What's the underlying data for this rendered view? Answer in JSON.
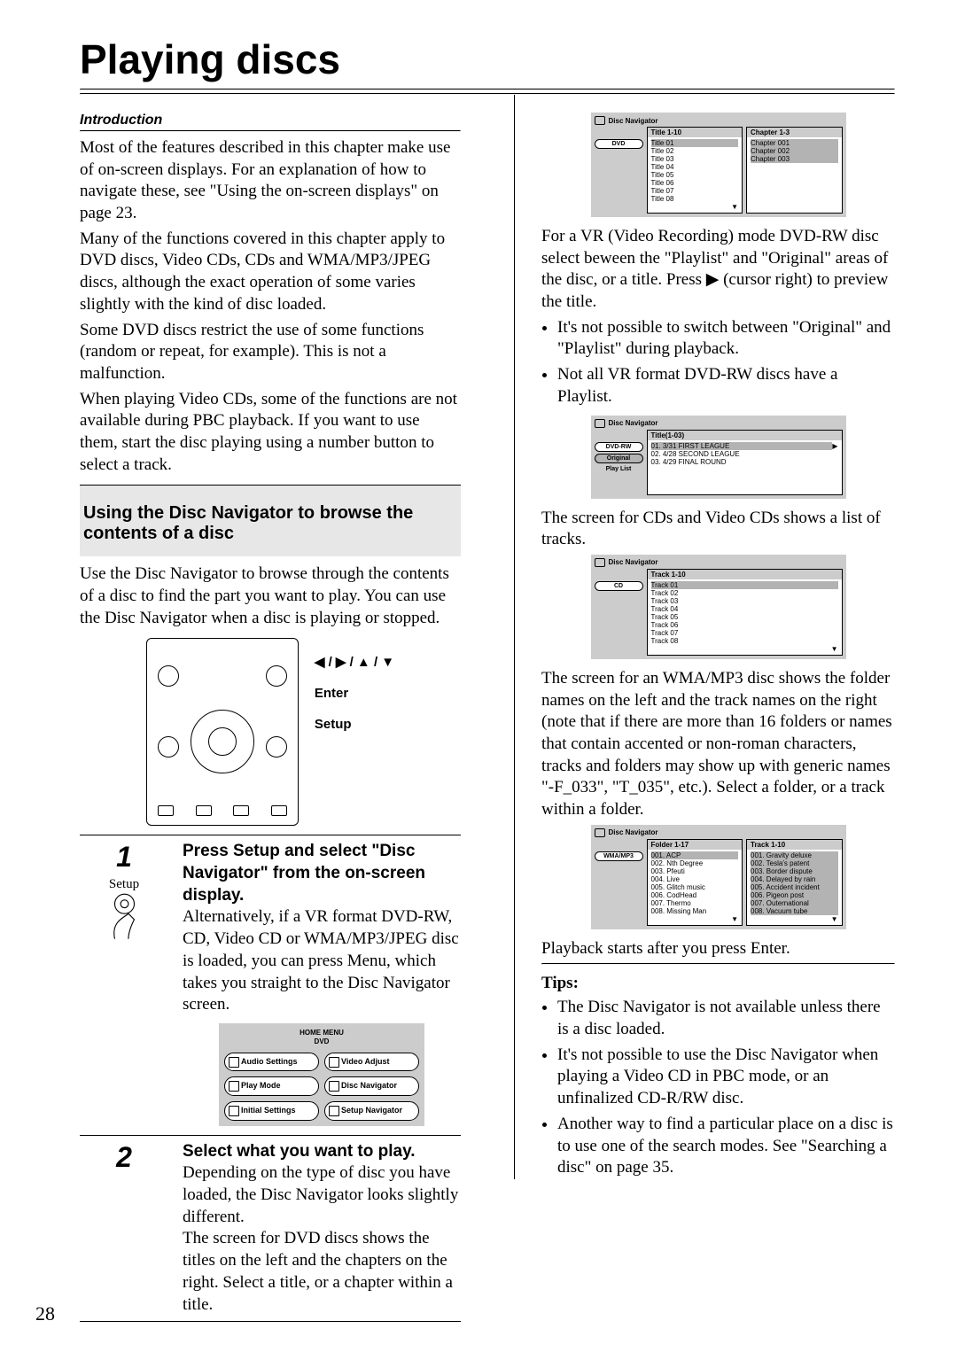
{
  "page": {
    "title": "Playing discs",
    "number": "28"
  },
  "intro": {
    "label": "Introduction",
    "p1": "Most of the features described in this chapter make use of on-screen displays. For an explanation of how to navigate these, see \"Using the on-screen displays\" on page 23.",
    "p2": "Many of the functions covered in this chapter apply to DVD discs, Video CDs, CDs and WMA/MP3/JPEG discs, although the exact operation of some varies slightly with the kind of disc loaded.",
    "p3": "Some DVD discs restrict the use of some functions (random or repeat, for example). This is not a malfunction.",
    "p4": "When playing Video CDs, some of the functions are not available during PBC playback. If you want to use them, start the disc playing using a number button to select a track."
  },
  "section": {
    "heading": "Using the Disc Navigator to browse the contents of a disc",
    "lead": "Use the Disc Navigator to browse through the contents of a disc to find the part you want to play. You can use the Disc Navigator when a disc is playing or stopped."
  },
  "remote_labels": {
    "arrows": "◀ / ▶ / ▲ / ▼",
    "enter": "Enter",
    "setup": "Setup"
  },
  "steps": {
    "n1": "1",
    "setup_label": "Setup",
    "s1_bold": "Press Setup and select \"Disc Navigator\" from the on-screen display.",
    "s1_body": "Alternatively, if a VR format DVD-RW, CD, Video CD or WMA/MP3/JPEG disc is loaded, you can press Menu, which takes you straight to the Disc Navigator screen.",
    "n2": "2",
    "s2_bold": "Select what you want to play.",
    "s2_body1": "Depending on the type of disc you have loaded, the Disc Navigator looks slightly different.",
    "s2_body2": "The screen for DVD discs shows the titles on the left and the chapters on the right. Select a title, or a chapter within a title."
  },
  "home_menu": {
    "title": "HOME MENU",
    "sub": "DVD",
    "b1": "Audio Settings",
    "b2": "Video Adjust",
    "b3": "Play Mode",
    "b4": "Disc Navigator",
    "b5": "Initial Settings",
    "b6": "Setup Navigator"
  },
  "osd1": {
    "label": "Disc Navigator",
    "type": "DVD",
    "col1_head": "Title 1-10",
    "col2_head": "Chapter 1-3",
    "titles": [
      "Title 01",
      "Title 02",
      "Title 03",
      "Title 04",
      "Title 05",
      "Title 06",
      "Title 07",
      "Title 08"
    ],
    "chapters": [
      "Chapter 001",
      "Chapter 002",
      "Chapter 003"
    ]
  },
  "right_p1": "For a VR (Video Recording) mode DVD-RW disc select beween the \"Playlist\" and \"Original\" areas of the disc, or a title. Press ▶ (cursor right) to preview the title.",
  "right_bullets1": [
    "It's not possible to switch between \"Original\" and \"Playlist\" during playback.",
    "Not all VR format DVD-RW discs have a Playlist."
  ],
  "osd2": {
    "label": "Disc Navigator",
    "type": "DVD-RW",
    "tabs": [
      "Original",
      "Play List"
    ],
    "col_head": "Title(1-03)",
    "items": [
      "01. 3/31 FIRST LEAGUE",
      "02. 4/28 SECOND LEAGUE",
      "03. 4/29 FINAL ROUND"
    ]
  },
  "right_p2": "The screen for CDs and Video CDs shows a list of tracks.",
  "osd3": {
    "label": "Disc Navigator",
    "type": "CD",
    "col_head": "Track 1-10",
    "items": [
      "Track 01",
      "Track 02",
      "Track 03",
      "Track 04",
      "Track 05",
      "Track 06",
      "Track 07",
      "Track 08"
    ]
  },
  "right_p3": "The screen for an WMA/MP3 disc shows the folder names on the left and the track names on the right (note that if there are more than 16 folders or names that contain accented or non-roman characters, tracks and folders may show up with generic names \"-F_033\", \"T_035\", etc.). Select a folder, or a track within a folder.",
  "osd4": {
    "label": "Disc Navigator",
    "type": "WMA/MP3",
    "c1_head": "Folder 1-17",
    "c2_head": "Track 1-10",
    "folders": [
      "001. ACP",
      "002. Nth Degree",
      "003. Pfeuti",
      "004. Live",
      "005. Glitch music",
      "006. CodHead",
      "007. Thermo",
      "008. Missing Man"
    ],
    "tracks": [
      "001. Gravity deluxe",
      "002. Tesla's patent",
      "003. Border dispute",
      "004. Delayed by rain",
      "005. Accident incident",
      "006. Pigeon post",
      "007. Outernational",
      "008. Vacuum tube"
    ]
  },
  "right_p4": "Playback starts after you press Enter.",
  "tips": {
    "heading": "Tips:",
    "items": [
      "The Disc Navigator is not available unless there is a disc loaded.",
      "It's not possible to use the Disc Navigator when playing a Video CD in PBC mode, or an unfinalized CD-R/RW disc.",
      "Another way to find a particular place on a disc is to use one of the search modes. See \"Searching a disc\" on page 35."
    ]
  }
}
